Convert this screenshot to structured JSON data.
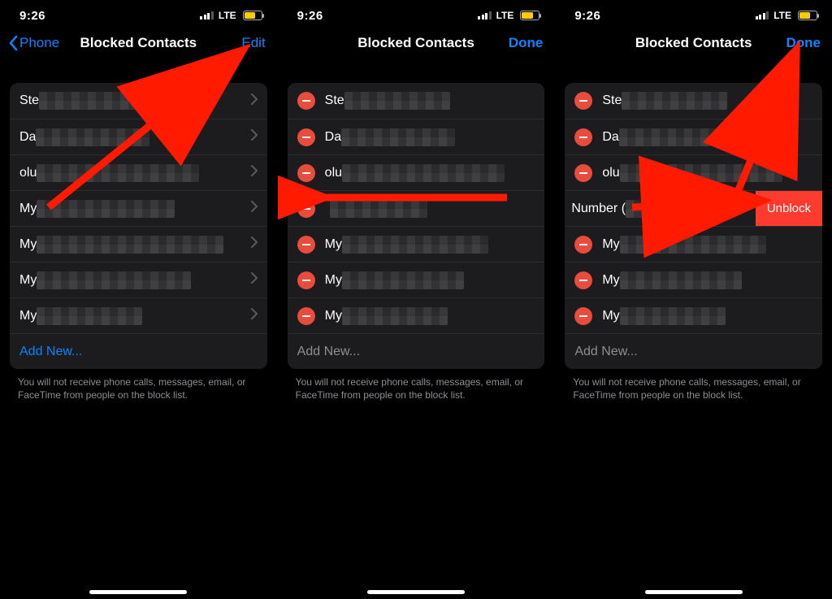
{
  "status": {
    "time": "9:26",
    "carrier": "LTE"
  },
  "nav": {
    "back_label": "Phone",
    "title": "Blocked Contacts",
    "edit": "Edit",
    "done": "Done"
  },
  "contacts": [
    {
      "prefix": "Ste",
      "pix_w": 130
    },
    {
      "prefix": "Da",
      "pix_w": 140
    },
    {
      "prefix": "olu",
      "pix_w": 200
    },
    {
      "prefix": "My",
      "pix_w": 170
    },
    {
      "prefix": "My",
      "pix_w": 230
    },
    {
      "prefix": "My",
      "pix_w": 190
    },
    {
      "prefix": "My",
      "pix_w": 130
    }
  ],
  "screen3_row4_label": "Number (",
  "add_new": "Add New...",
  "unblock": "Unblock",
  "footer": "You will not receive phone calls, messages, email, or FaceTime from people on the block list."
}
